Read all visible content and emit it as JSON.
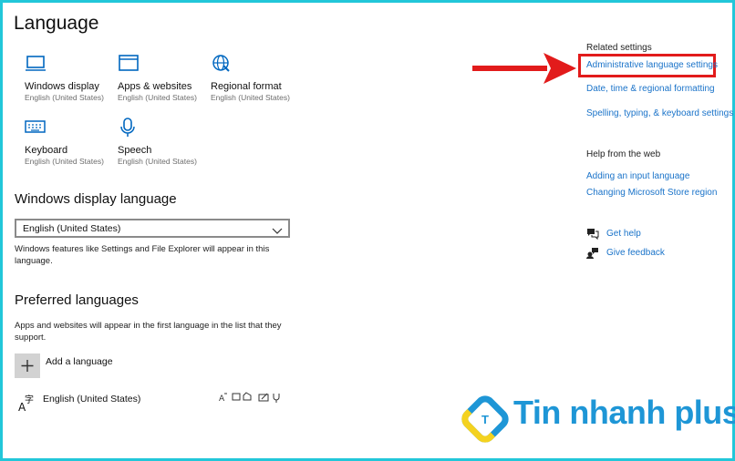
{
  "page": {
    "title": "Language"
  },
  "tiles": [
    {
      "label": "Windows display",
      "sub": "English (United States)",
      "icon": "monitor-icon"
    },
    {
      "label": "Apps & websites",
      "sub": "English (United States)",
      "icon": "app-window-icon"
    },
    {
      "label": "Regional format",
      "sub": "English (United States)",
      "icon": "globe-format-icon"
    },
    {
      "label": "Keyboard",
      "sub": "English (United States)",
      "icon": "keyboard-icon"
    },
    {
      "label": "Speech",
      "sub": "English (United States)",
      "icon": "microphone-icon"
    }
  ],
  "display_language": {
    "heading": "Windows display language",
    "selected": "English (United States)",
    "description": "Windows features like Settings and File Explorer will appear in this language."
  },
  "preferred": {
    "heading": "Preferred languages",
    "description": "Apps and websites will appear in the first language in the list that they support.",
    "add_label": "Add a language",
    "languages": [
      {
        "name": "English (United States)"
      }
    ]
  },
  "related": {
    "heading": "Related settings",
    "links": [
      "Administrative language settings",
      "Date, time & regional formatting",
      "Spelling, typing, & keyboard settings"
    ]
  },
  "help_web": {
    "heading": "Help from the web",
    "links": [
      "Adding an input language",
      "Changing Microsoft Store region"
    ]
  },
  "support": {
    "get_help": "Get help",
    "feedback": "Give feedback"
  },
  "watermark": {
    "text": "Tin nhanh plus",
    "logo_letter": "T"
  },
  "colors": {
    "accent": "#0067c0",
    "link": "#1a73c9",
    "highlight": "#e21b1b",
    "frame": "#22c7d9",
    "watermark": "#1e96d6"
  }
}
